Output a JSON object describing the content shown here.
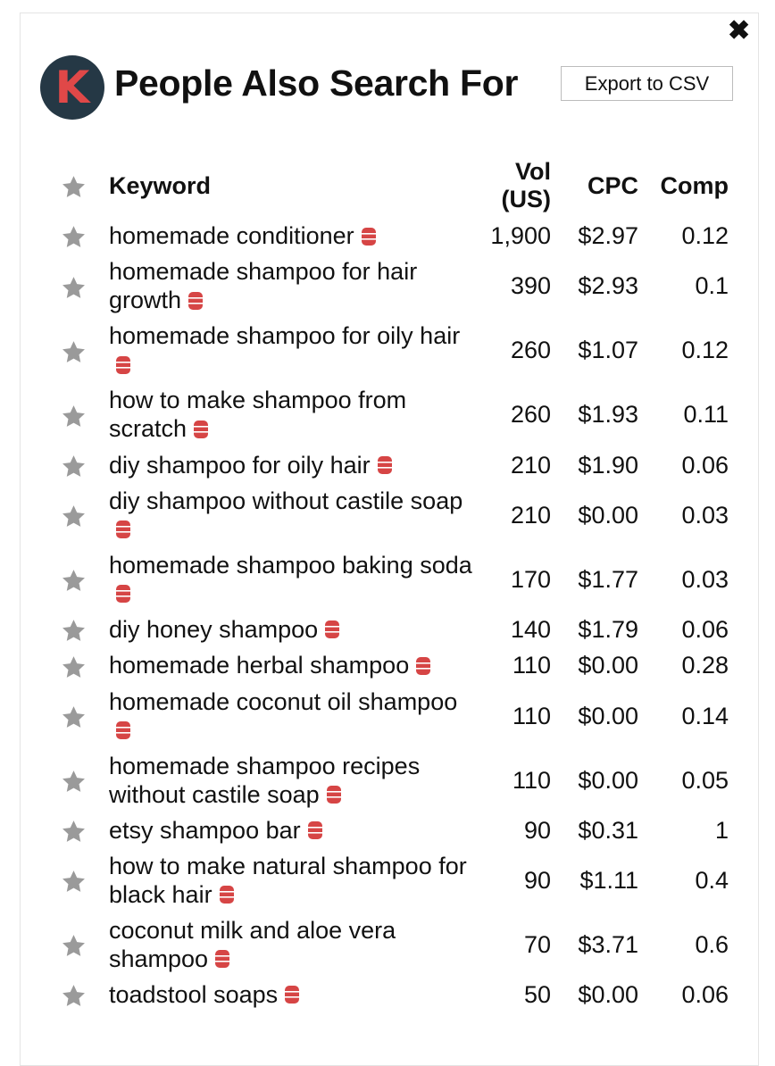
{
  "header": {
    "close_icon": "close-icon",
    "logo_letter": "K",
    "title": "People Also Search For",
    "export_label": "Export to CSV"
  },
  "colors": {
    "logo_bg": "#253845",
    "logo_letter": "#e04848",
    "star": "#9a9a9a",
    "db_icon": "#d64545"
  },
  "table": {
    "columns": {
      "keyword": "Keyword",
      "vol_line1": "Vol",
      "vol_line2": "(US)",
      "cpc": "CPC",
      "comp": "Comp"
    },
    "rows": [
      {
        "keyword": "homemade conditioner",
        "vol": "1,900",
        "cpc": "$2.97",
        "comp": "0.12"
      },
      {
        "keyword": "homemade shampoo for hair growth",
        "vol": "390",
        "cpc": "$2.93",
        "comp": "0.1"
      },
      {
        "keyword": "homemade shampoo for oily hair",
        "vol": "260",
        "cpc": "$1.07",
        "comp": "0.12"
      },
      {
        "keyword": "how to make shampoo from scratch",
        "vol": "260",
        "cpc": "$1.93",
        "comp": "0.11"
      },
      {
        "keyword": "diy shampoo for oily hair",
        "vol": "210",
        "cpc": "$1.90",
        "comp": "0.06"
      },
      {
        "keyword": "diy shampoo without castile soap",
        "vol": "210",
        "cpc": "$0.00",
        "comp": "0.03"
      },
      {
        "keyword": "homemade shampoo baking soda",
        "vol": "170",
        "cpc": "$1.77",
        "comp": "0.03"
      },
      {
        "keyword": "diy honey shampoo",
        "vol": "140",
        "cpc": "$1.79",
        "comp": "0.06"
      },
      {
        "keyword": "homemade herbal shampoo",
        "vol": "110",
        "cpc": "$0.00",
        "comp": "0.28"
      },
      {
        "keyword": "homemade coconut oil shampoo",
        "vol": "110",
        "cpc": "$0.00",
        "comp": "0.14"
      },
      {
        "keyword": "homemade shampoo recipes without castile soap",
        "vol": "110",
        "cpc": "$0.00",
        "comp": "0.05"
      },
      {
        "keyword": "etsy shampoo bar",
        "vol": "90",
        "cpc": "$0.31",
        "comp": "1"
      },
      {
        "keyword": "how to make natural shampoo for black hair",
        "vol": "90",
        "cpc": "$1.11",
        "comp": "0.4"
      },
      {
        "keyword": "coconut milk and aloe vera shampoo",
        "vol": "70",
        "cpc": "$3.71",
        "comp": "0.6"
      },
      {
        "keyword": "toadstool soaps",
        "vol": "50",
        "cpc": "$0.00",
        "comp": "0.06"
      }
    ]
  }
}
